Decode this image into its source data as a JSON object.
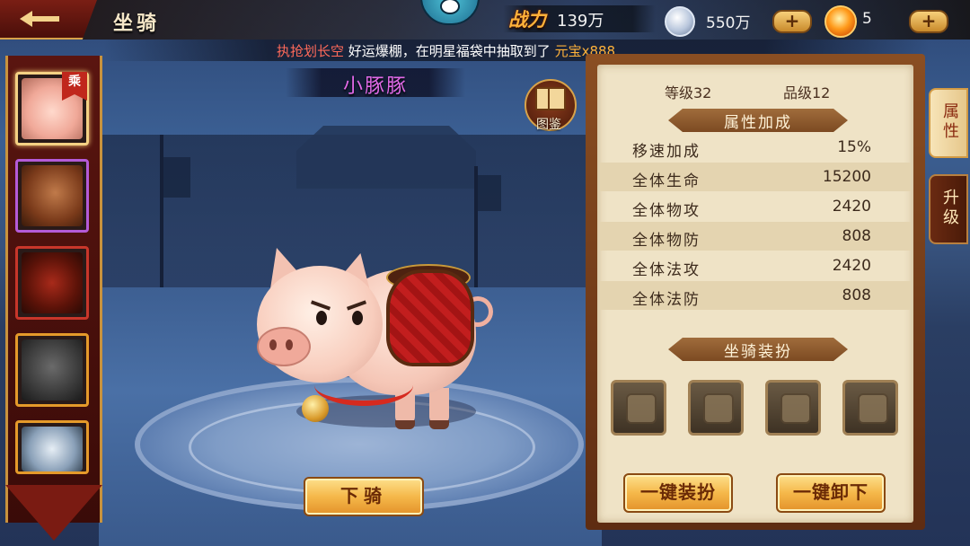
{
  "header": {
    "page_title": "坐骑",
    "power_label": "战力",
    "power_value": "139万",
    "silver_value": "550万",
    "gold_value": "5",
    "plus_symbol": "+"
  },
  "marquee": {
    "player": "执抢划长空",
    "middle": " 好运爆棚，在明星福袋中抽取到了 ",
    "reward": "元宝x888"
  },
  "mounts": [
    {
      "name": "pig",
      "selected": true,
      "riding": true
    },
    {
      "name": "horse",
      "selected": false
    },
    {
      "name": "red-beast",
      "selected": false
    },
    {
      "name": "wolf",
      "selected": false
    },
    {
      "name": "white-tiger",
      "selected": false
    }
  ],
  "ride_tag": "乘",
  "mount_name": "小豚豚",
  "codex_label": "图鉴",
  "dismount_label": "下骑",
  "stats": {
    "level": "等级32",
    "grade": "品级12"
  },
  "attr_section_title": "属性加成",
  "attributes": [
    {
      "name": "移速加成",
      "value": "15%"
    },
    {
      "name": "全体生命",
      "value": "15200"
    },
    {
      "name": "全体物攻",
      "value": "2420"
    },
    {
      "name": "全体物防",
      "value": "808"
    },
    {
      "name": "全体法攻",
      "value": "2420"
    },
    {
      "name": "全体法防",
      "value": "808"
    }
  ],
  "outfit_section_title": "坐骑装扮",
  "outfit_slots": [
    "bridle",
    "saddle",
    "armor",
    "harness"
  ],
  "buttons": {
    "equip_all": "一键装扮",
    "unequip_all": "一键卸下"
  },
  "side_tabs": [
    {
      "label": "属性",
      "active": true
    },
    {
      "label": "升级",
      "active": false
    }
  ],
  "colors": {
    "mount_name": "#e26ae8",
    "power_label": "#ffb23a",
    "marquee_player": "#ff6a5a",
    "marquee_reward": "#ffb23a"
  }
}
